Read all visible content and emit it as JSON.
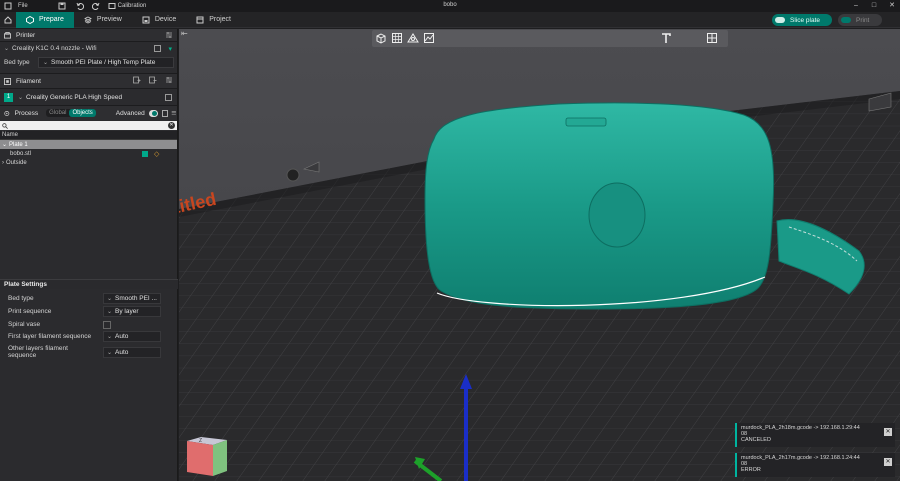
{
  "window": {
    "title": "bobo",
    "menu": [
      {
        "label": "File"
      },
      {
        "label": "Calibration"
      }
    ]
  },
  "tabs": [
    {
      "label": "Prepare",
      "active": true
    },
    {
      "label": "Preview"
    },
    {
      "label": "Device"
    },
    {
      "label": "Project"
    }
  ],
  "actions": {
    "slice": "Slice plate",
    "print": "Print"
  },
  "printer": {
    "header": "Printer",
    "name": "Creality K1C 0.4 nozzle - Wifi",
    "bed_type_label": "Bed type",
    "bed_type_value": "Smooth PEI Plate / High Temp Plate"
  },
  "filament": {
    "header": "Filament",
    "index": "1",
    "name": "Creality Generic PLA High Speed"
  },
  "process": {
    "header": "Process",
    "toggle_global": "Global",
    "toggle_objects": "Objects",
    "advanced_label": "Advanced"
  },
  "objects": {
    "column_name": "Name",
    "rows": [
      {
        "label": "Plate 1"
      },
      {
        "label": "bobo.stl"
      },
      {
        "label": "Outside"
      }
    ]
  },
  "plate_settings": {
    "header": "Plate Settings",
    "rows": [
      {
        "label": "Bed type",
        "value": "Smooth PEI ..."
      },
      {
        "label": "Print sequence",
        "value": "By layer"
      },
      {
        "label": "Spiral vase",
        "value": ""
      },
      {
        "label": "First layer filament sequence",
        "value": "Auto"
      },
      {
        "label": "Other layers filament sequence",
        "value": "Auto"
      }
    ]
  },
  "viewport": {
    "plate_label": "titled"
  },
  "notifications": [
    {
      "line1": "murdock_PLA_2h18m.gcode -> 192.168.1.29:44",
      "line2": "08",
      "status": "CANCELED"
    },
    {
      "line1": "murdock_PLA_2h17m.gcode -> 192.168.1.24:44",
      "line2": "08",
      "status": "ERROR"
    }
  ],
  "colors": {
    "accent": "#00796b",
    "model": "#1a9a88"
  }
}
